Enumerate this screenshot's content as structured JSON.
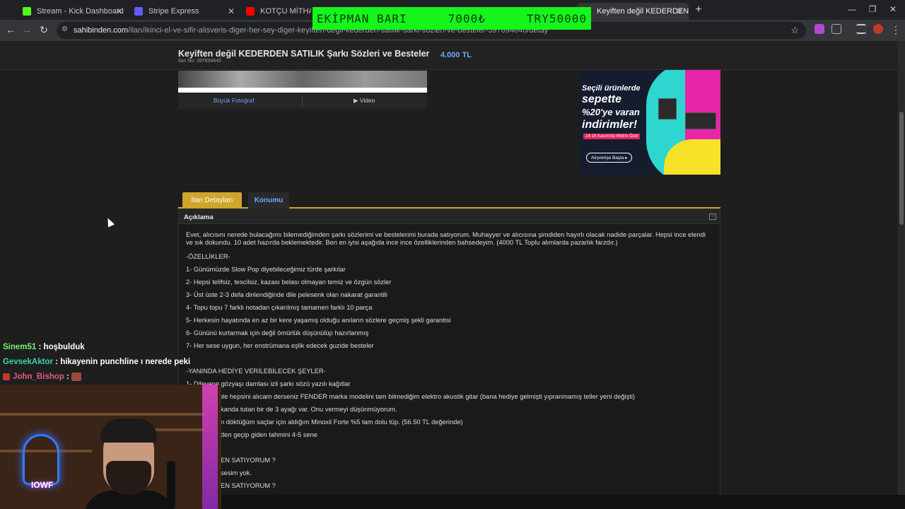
{
  "browser": {
    "tabs": [
      {
        "title": "Stream - Kick Dashboard",
        "favicon_color": "#53fc18"
      },
      {
        "title": "Stripe Express",
        "favicon_color": "#635bff"
      },
      {
        "title": "KOTÇU MİTHAT - YouT",
        "favicon_color": "#ff0000"
      },
      {
        "title": "Keyiften değil KEDERDEN SATILIK",
        "favicon_color": "#f6c30a"
      }
    ],
    "url_domain": "sahibinden.com",
    "url_path": "/ilan/ikinci-el-ve-sifir-alisveris-diger-her-sey-diger-keyiften-degil-kederden-satilik-sarki-sozleri-ve-besteler-397694640/detay"
  },
  "overlay": {
    "label": "EKİPMAN BARI",
    "amount": "7000₺",
    "goal": "TRY50000"
  },
  "listing": {
    "title": "Keyiften değil KEDERDEN SATILIK Şarkı Sözleri ve Besteler",
    "listing_no": "İlan No: 397694640",
    "price": "4.000 TL",
    "photo_link": "Büyük Fotoğraf",
    "video_link": "Video",
    "tabs": [
      "İlan Detayları",
      "Konumu"
    ],
    "section_title": "Açıklama",
    "description": "Evet, alıcısını nerede bulacağımı bilemediğimden şarkı sözlerimi ve bestelerimi burada satıyorum. Muhayyer ve alıcısına şimdiden hayırlı olacak nadide parçalar. Hepsi ince elendi ve sık dokundu. 10 adet hazırda beklemektedir. Ben en iyisi aşağıda ince ince özelliklerinden bahsedeyim. (4000 TL Toplu alımlarda pazarlık farzdır.)",
    "features_header": "-ÖZELLİKLER-",
    "features": [
      "1- Günümüzde Slow Pop diyebileceğimiz türde şarkılar",
      "2- Hepsi telifsiz, tescilsiz, kazası belası olmayan temiz ve özgün sözler",
      "3- Üst üste 2-3 defa dinlendiğinde dile pelesenk olan nakarat garantili",
      "4- Topu topu 7 farklı notadan çıkarılmış tamamen farklı 10 parça",
      "5- Herkesin hayatında en az bir kere yaşamış olduğu anıların sözlere geçmiş şekli garantisi",
      "6- Gününü kurtarmak için değil ömürlük düşünülüp hazırlanmış",
      "7- Her sese uygun, her enstrümana eşlik edecek guzide besteler"
    ],
    "gifts_header": "-YANINDA HEDİYE VERİLEBİLECEK ŞEYLER-",
    "gifts": [
      "1- Dilevene gözyaşı damlası izli şarkı sözü yazılı kağıtlar",
      "ple hepsini alıcam derseniz FENDER marka modelini tam bilmediğim elektro akustik gitar (bana hediye gelmişti yıpranmamış teller yeni değişti)",
      "kanda tutan bir de 3 ayağı var. Onu vermeyi düşünmüyorum.",
      "n döktüğüm saçlar için aldığım Minoxil Forte %5 tam dolu tüp. (56.50 TL değerinde)",
      "den geçip giden tahmini 4-5 sene"
    ],
    "tail_lines": [
      "EN SATIYORUM ?",
      "sesim yok.",
      "EN SATIYORUM ?"
    ]
  },
  "ad": {
    "line1": "Seçili ürünlerde",
    "line2": "sepette",
    "line3": "%20'ye varan",
    "line4": "indirimler!",
    "line5": "14-16 Kasım'da Web'e Özel",
    "button": "Alışverişe Başla"
  },
  "chat": [
    {
      "user": "Sinem51",
      "message": ": hoşbulduk"
    },
    {
      "user": "GevsekAktor",
      "message": ": hikayenin punchline ı nerede peki"
    },
    {
      "user": "John_Bishop",
      "message": ":"
    }
  ],
  "webcam": {
    "neon_text": "IOWF"
  }
}
